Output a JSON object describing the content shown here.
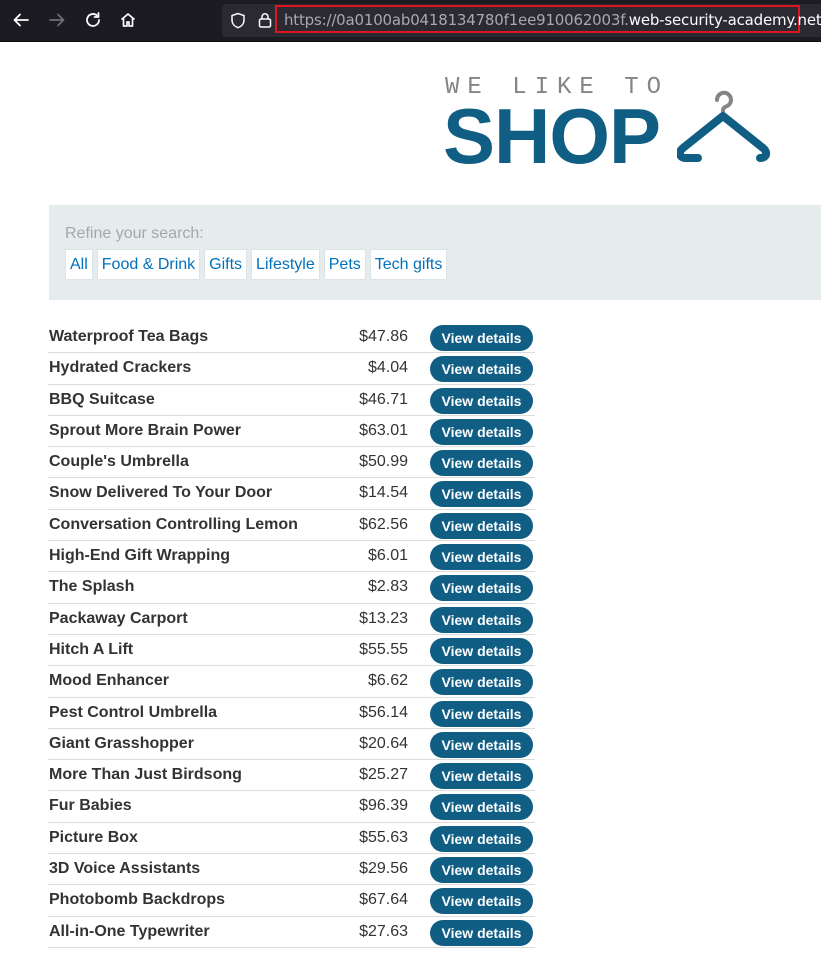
{
  "browser": {
    "url_prefix": "https://0a0100ab0418134780f1ee910062003f.",
    "url_host": "web-security-academy.net",
    "icons": [
      "back-arrow-icon",
      "forward-arrow-icon",
      "reload-icon",
      "home-icon",
      "shield-icon",
      "lock-icon"
    ]
  },
  "logo": {
    "small_text": "WE LIKE TO",
    "big_text": "SHOP",
    "icon": "hanger-icon",
    "color": "#115e85"
  },
  "filter": {
    "label": "Refine your search:",
    "categories": [
      "All",
      "Food & Drink",
      "Gifts",
      "Lifestyle",
      "Pets",
      "Tech gifts"
    ]
  },
  "button_label": "View details",
  "products": [
    {
      "name": "Waterproof Tea Bags",
      "price": "$47.86"
    },
    {
      "name": "Hydrated Crackers",
      "price": "$4.04"
    },
    {
      "name": "BBQ Suitcase",
      "price": "$46.71"
    },
    {
      "name": "Sprout More Brain Power",
      "price": "$63.01"
    },
    {
      "name": "Couple's Umbrella",
      "price": "$50.99"
    },
    {
      "name": "Snow Delivered To Your Door",
      "price": "$14.54"
    },
    {
      "name": "Conversation Controlling Lemon",
      "price": "$62.56"
    },
    {
      "name": "High-End Gift Wrapping",
      "price": "$6.01"
    },
    {
      "name": "The Splash",
      "price": "$2.83"
    },
    {
      "name": "Packaway Carport",
      "price": "$13.23"
    },
    {
      "name": "Hitch A Lift",
      "price": "$55.55"
    },
    {
      "name": "Mood Enhancer",
      "price": "$6.62"
    },
    {
      "name": "Pest Control Umbrella",
      "price": "$56.14"
    },
    {
      "name": "Giant Grasshopper",
      "price": "$20.64"
    },
    {
      "name": "More Than Just Birdsong",
      "price": "$25.27"
    },
    {
      "name": "Fur Babies",
      "price": "$96.39"
    },
    {
      "name": "Picture Box",
      "price": "$55.63"
    },
    {
      "name": "3D Voice Assistants",
      "price": "$29.56"
    },
    {
      "name": "Photobomb Backdrops",
      "price": "$67.64"
    },
    {
      "name": "All-in-One Typewriter",
      "price": "$27.63"
    }
  ]
}
